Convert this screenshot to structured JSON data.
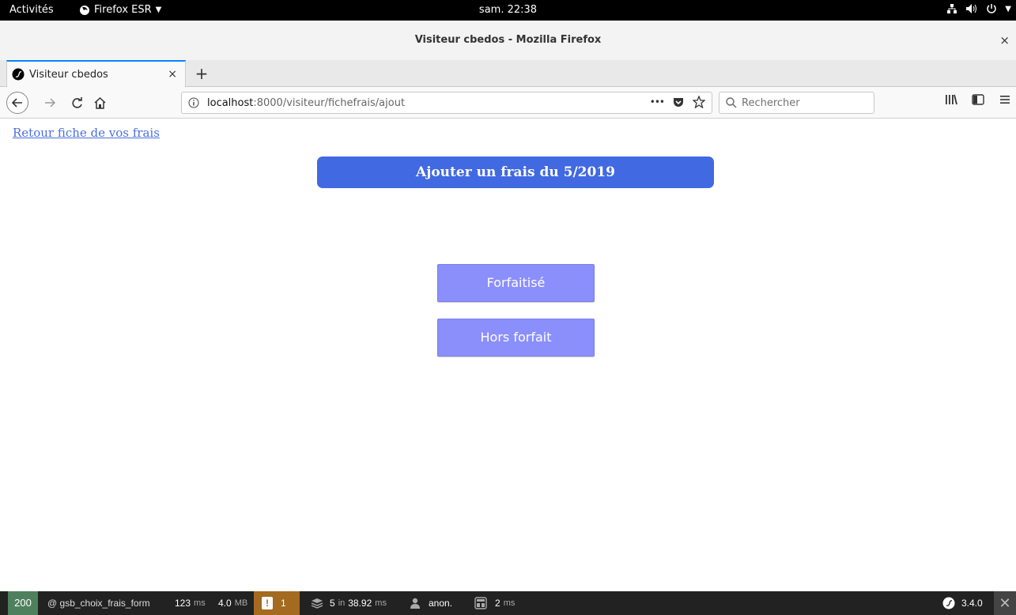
{
  "system_bar": {
    "activities": "Activités",
    "app_menu": "Firefox ESR",
    "clock": "sam. 22:38"
  },
  "window": {
    "title": "Visiteur cbedos - Mozilla Firefox",
    "close": "×"
  },
  "tabs": [
    {
      "title": "Visiteur cbedos",
      "close": "×"
    }
  ],
  "newtab": "+",
  "urlbar": {
    "host": "localhost",
    "path": ":8000/visiteur/fichefrais/ajout",
    "more": "•••"
  },
  "search": {
    "placeholder": "Rechercher"
  },
  "page": {
    "back_link": "Retour fiche de vos frais",
    "heading": "Ajouter un frais du 5/2019",
    "buttons": [
      "Forfaitisé",
      "Hors forfait"
    ]
  },
  "symfony_toolbar": {
    "status_code": "200",
    "route": "@ gsb_choix_frais_form",
    "time_value": "123",
    "time_unit": "ms",
    "memory_value": "4.0",
    "memory_unit": "MB",
    "logs_count": "1",
    "db_queries": "5",
    "db_in": "in",
    "db_time": "38.92",
    "db_unit": "ms",
    "user": "anon.",
    "twig_time": "2",
    "twig_unit": "ms",
    "version": "3.4.0"
  },
  "colors": {
    "heading_bg": "#4169e1",
    "button_bg": "#8b8ffc",
    "link": "#4a6fe0",
    "status_ok": "#4f805d",
    "warning": "#a46a1f"
  }
}
